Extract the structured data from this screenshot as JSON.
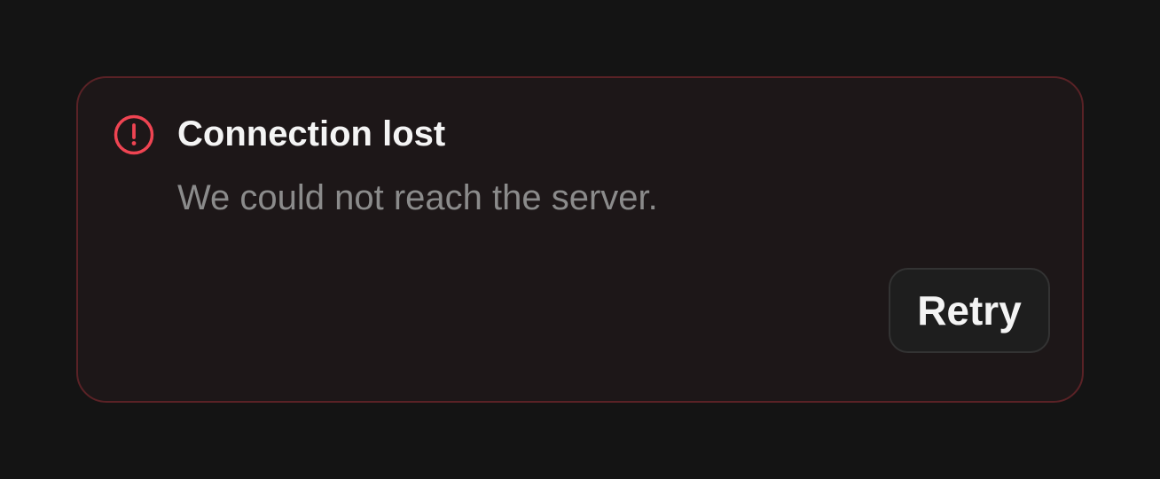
{
  "alert": {
    "icon": "alert-circle-icon",
    "title": "Connection lost",
    "message": "We could not reach the server.",
    "retry_label": "Retry"
  },
  "colors": {
    "page_background": "#141414",
    "card_background": "#1d1718",
    "card_border": "#5a2226",
    "accent_error": "#ef4452",
    "title_text": "#f4f4f4",
    "message_text": "#8b8b8b"
  }
}
